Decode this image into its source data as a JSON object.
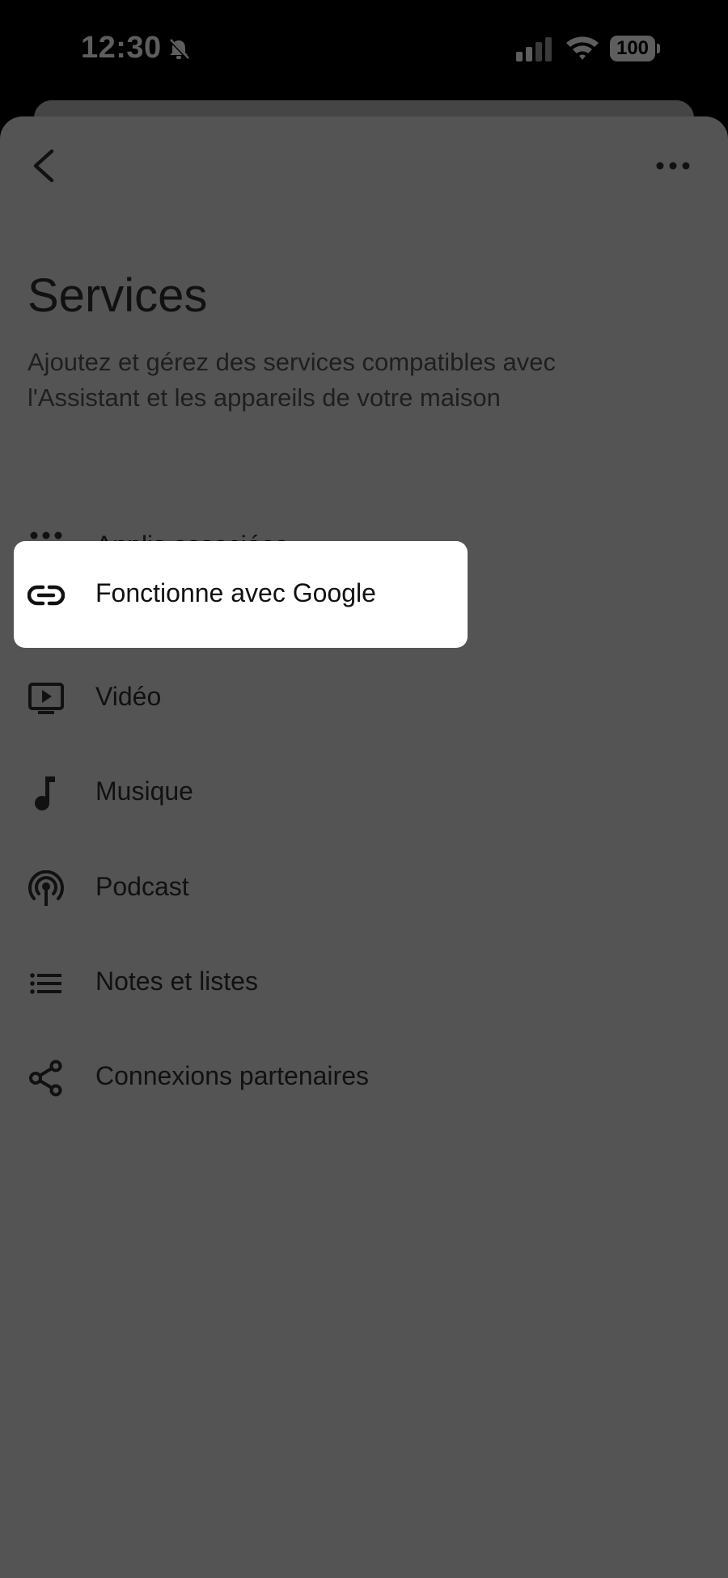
{
  "status_bar": {
    "time": "12:30",
    "battery": "100"
  },
  "header": {
    "title": "Services",
    "subtitle_line1": "Ajoutez et gérez des services compatibles avec",
    "subtitle_line2": "l'Assistant et les appareils de votre maison"
  },
  "menu": {
    "items": [
      {
        "label": "Applis associées",
        "icon": "apps-grid-icon"
      },
      {
        "label": "Fonctionne avec Google",
        "icon": "link-icon"
      },
      {
        "label": "Vidéo",
        "icon": "tv-play-icon"
      },
      {
        "label": "Musique",
        "icon": "music-note-icon"
      },
      {
        "label": "Podcast",
        "icon": "podcast-icon"
      },
      {
        "label": "Notes et listes",
        "icon": "list-icon"
      },
      {
        "label": "Connexions partenaires",
        "icon": "share-icon"
      }
    ]
  },
  "colors": {
    "sheet_background": "#545454",
    "highlight_background": "#ffffff",
    "text_primary": "#111111"
  }
}
